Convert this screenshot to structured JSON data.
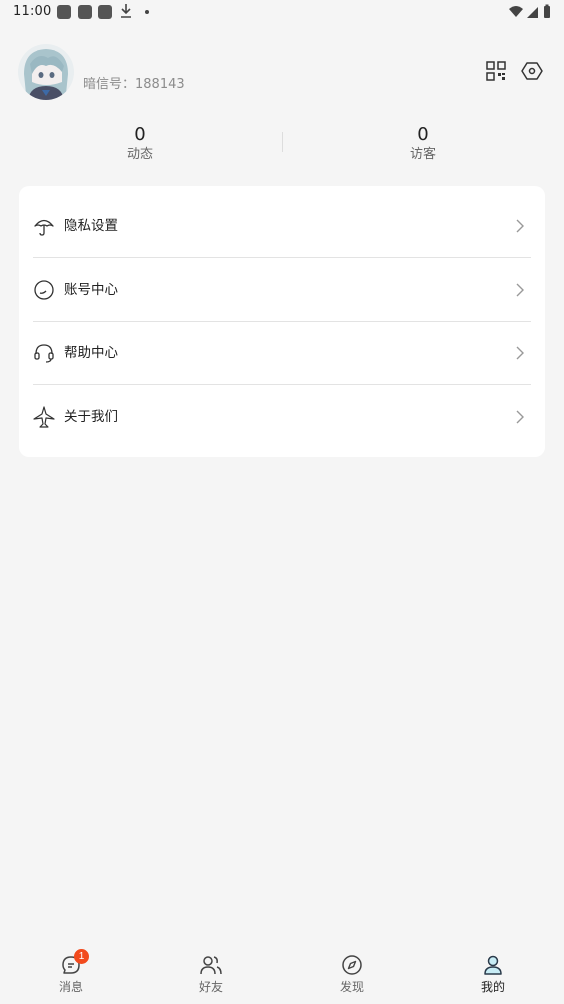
{
  "status_bar": {
    "time": "11:00"
  },
  "profile": {
    "user_id_label": "暗信号：188143",
    "avatar_icon": "avatar-anime-girl",
    "qr_icon": "qr-code-icon",
    "settings_icon": "settings-hexagon-icon"
  },
  "stats": [
    {
      "count": "0",
      "label": "动态"
    },
    {
      "count": "0",
      "label": "访客"
    }
  ],
  "menu": [
    {
      "label": "隐私设置",
      "icon": "umbrella-icon"
    },
    {
      "label": "账号中心",
      "icon": "account-circle-icon"
    },
    {
      "label": "帮助中心",
      "icon": "headset-icon"
    },
    {
      "label": "关于我们",
      "icon": "airplane-icon"
    }
  ],
  "nav": [
    {
      "label": "消息",
      "icon": "message-icon",
      "badge": "1"
    },
    {
      "label": "好友",
      "icon": "friends-icon"
    },
    {
      "label": "发现",
      "icon": "compass-icon"
    },
    {
      "label": "我的",
      "icon": "user-icon",
      "active": true
    }
  ],
  "colors": {
    "background": "#f5f5f5",
    "card": "#ffffff",
    "badge": "#f24a1d",
    "active_icon": "#3aa3c4"
  }
}
